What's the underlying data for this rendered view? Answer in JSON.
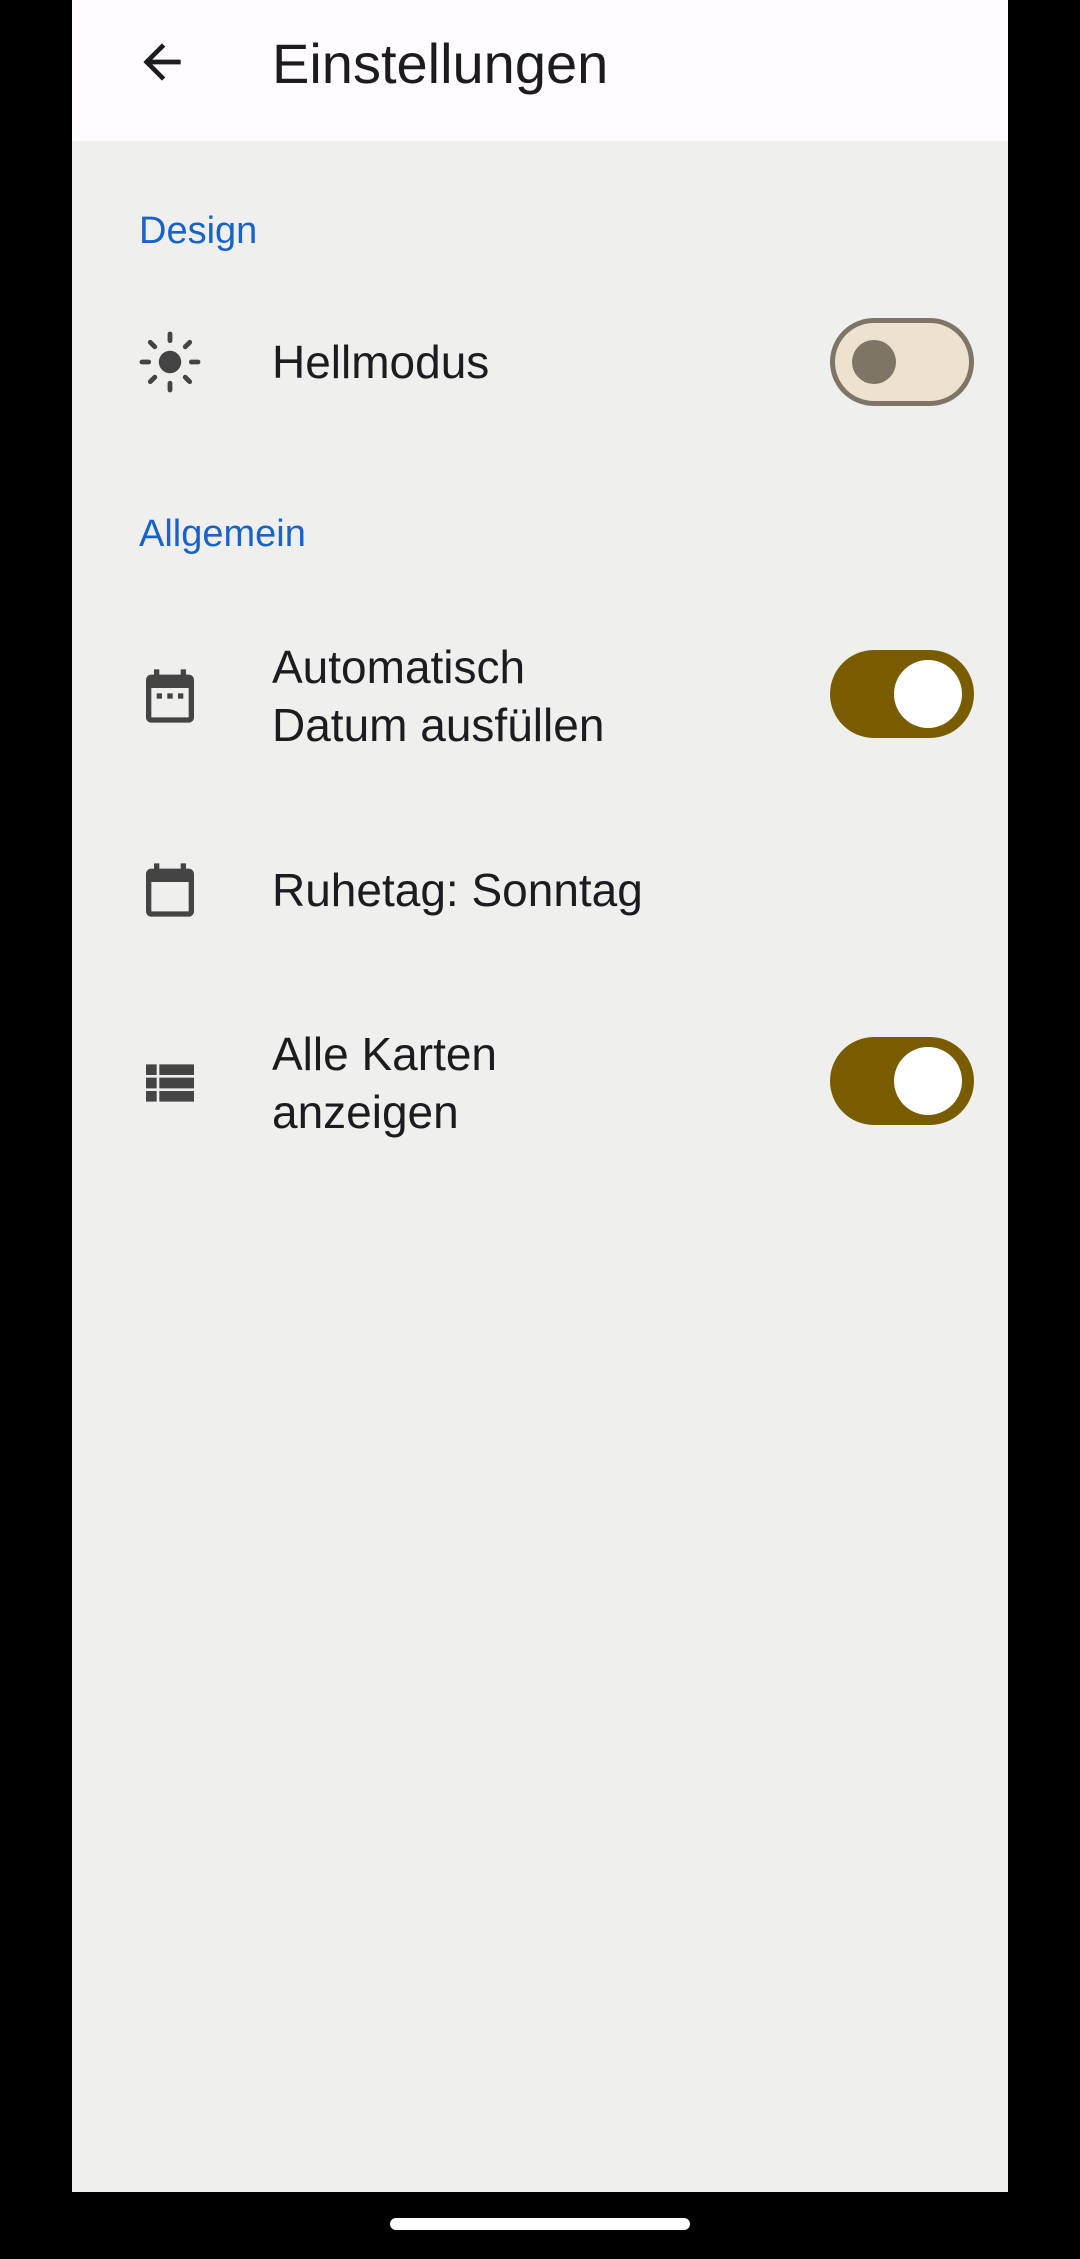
{
  "appbar": {
    "title": "Einstellungen",
    "back_icon": "arrow-back-icon"
  },
  "sections": {
    "design": {
      "header": "Design",
      "items": {
        "light_mode": {
          "label": "Hellmodus",
          "icon": "brightness-icon",
          "toggle": "off"
        }
      }
    },
    "general": {
      "header": "Allgemein",
      "items": {
        "auto_date": {
          "label_line1": "Automatisch",
          "label_line2": "Datum ausfüllen",
          "icon": "calendar-dots-icon",
          "toggle": "on"
        },
        "rest_day": {
          "label": "Ruhetag: Sonntag",
          "icon": "calendar-icon"
        },
        "show_all_cards": {
          "label_line1": "Alle Karten",
          "label_line2": "anzeigen",
          "icon": "list-icon",
          "toggle": "on"
        }
      }
    }
  },
  "colors": {
    "accent": "#1a63c6",
    "switch_on": "#7a5c00",
    "switch_off_track": "#ede2d0",
    "switch_off_outline": "#7e7566",
    "background": "#efefee",
    "appbar": "#fffbfe"
  }
}
